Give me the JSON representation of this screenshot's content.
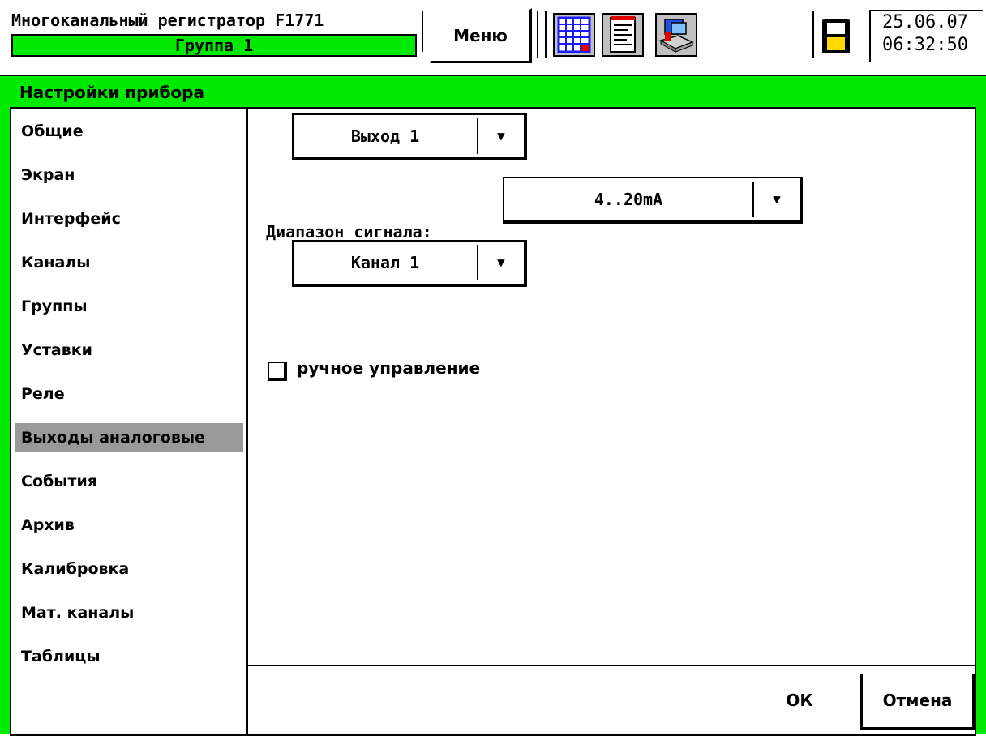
{
  "header": {
    "device_title": "Многоканальный регистратор F1771",
    "group": "Группа 1",
    "menu_label": "Меню",
    "date": "25.06.07",
    "time": "06:32:50",
    "accent_color": "#00ea00"
  },
  "toolbar_icons": [
    "table-icon",
    "notepad-icon",
    "device-archive-icon",
    "floppy-save-icon"
  ],
  "panel": {
    "title": "Настройки прибора"
  },
  "sidebar": {
    "items": [
      {
        "label": "Общие"
      },
      {
        "label": "Экран"
      },
      {
        "label": "Интерфейс"
      },
      {
        "label": "Каналы"
      },
      {
        "label": "Группы"
      },
      {
        "label": "Уставки"
      },
      {
        "label": "Реле"
      },
      {
        "label": "Выходы аналоговые"
      },
      {
        "label": "События"
      },
      {
        "label": "Архив"
      },
      {
        "label": "Калибровка"
      },
      {
        "label": "Мат. каналы"
      },
      {
        "label": "Таблицы"
      }
    ],
    "active": "Выходы аналоговые"
  },
  "content": {
    "output_select": "Выход 1",
    "signal_range_label": "Диапазон сигнала:",
    "signal_range_value": "4..20mA",
    "channel_select": "Канал 1",
    "manual_control_label": "ручное управление",
    "manual_control_checked": false
  },
  "buttons": {
    "ok": "ОК",
    "cancel": "Отмена"
  }
}
